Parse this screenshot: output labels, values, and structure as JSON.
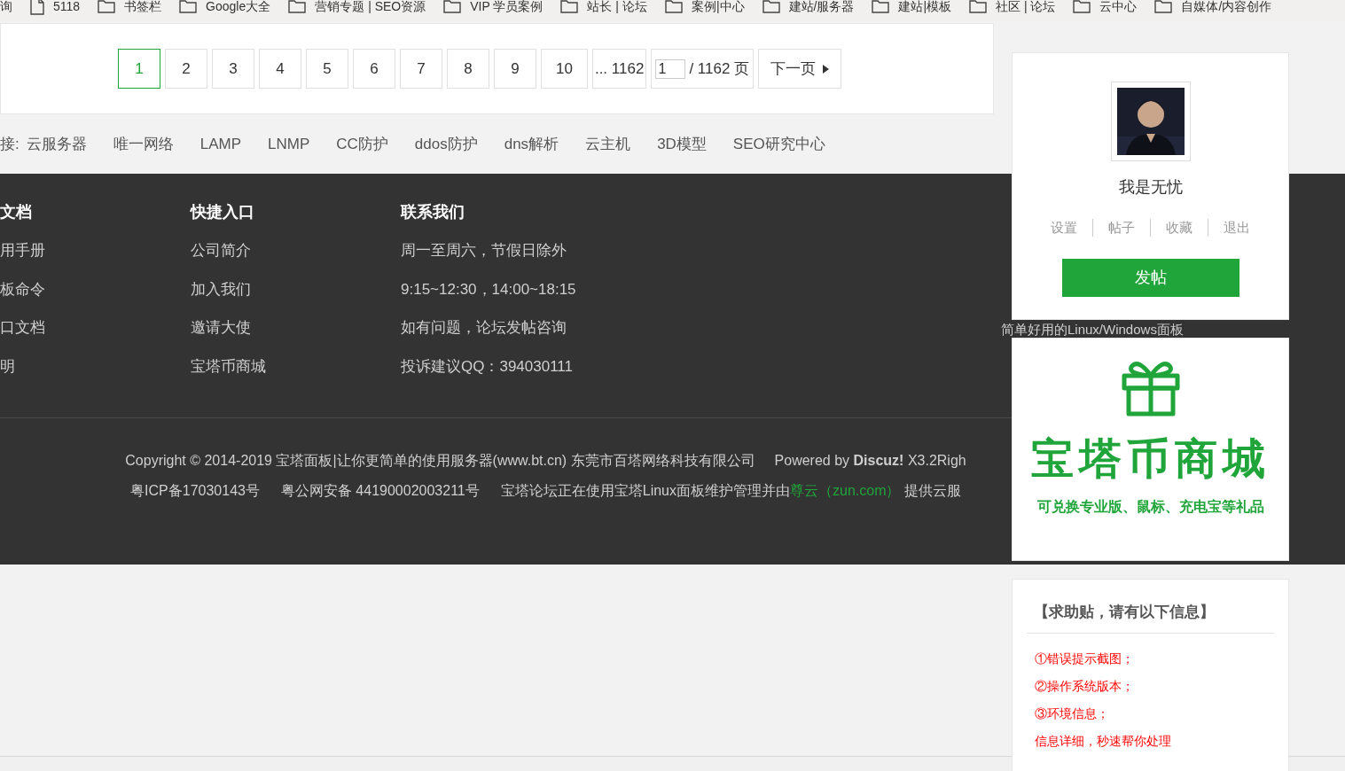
{
  "bookmarks": [
    {
      "kind": "text",
      "label": "询"
    },
    {
      "kind": "page",
      "label": "5118"
    },
    {
      "kind": "folder",
      "label": "书签栏"
    },
    {
      "kind": "folder",
      "label": "Google大全"
    },
    {
      "kind": "folder",
      "label": "营销专题 | SEO资源"
    },
    {
      "kind": "folder",
      "label": "VIP 学员案例"
    },
    {
      "kind": "folder",
      "label": "站长 | 论坛"
    },
    {
      "kind": "folder",
      "label": "案例|中心"
    },
    {
      "kind": "folder",
      "label": "建站/服务器"
    },
    {
      "kind": "folder",
      "label": "建站|模板"
    },
    {
      "kind": "folder",
      "label": "社区 | 论坛"
    },
    {
      "kind": "folder",
      "label": "云中心"
    },
    {
      "kind": "folder",
      "label": "自媒体/内容创作"
    }
  ],
  "pagination": {
    "pages": [
      {
        "label": "1",
        "selected": true
      },
      {
        "label": "2",
        "selected": false
      },
      {
        "label": "3",
        "selected": false
      },
      {
        "label": "4",
        "selected": false
      },
      {
        "label": "5",
        "selected": false
      },
      {
        "label": "6",
        "selected": false
      },
      {
        "label": "7",
        "selected": false
      },
      {
        "label": "8",
        "selected": false
      },
      {
        "label": "9",
        "selected": false
      },
      {
        "label": "10",
        "selected": false
      }
    ],
    "last": "... 1162",
    "page_input": "1",
    "total": "/ 1162 页",
    "next": "下一页"
  },
  "links": {
    "label": "接:",
    "items": [
      "云服务器",
      "唯一网络",
      "LAMP",
      "LNMP",
      "CC防护",
      "ddos防护",
      "dns解析",
      "云主机",
      "3D模型",
      "SEO研究中心"
    ]
  },
  "footer": {
    "columns": [
      {
        "title": "文档",
        "items": [
          "用手册",
          "板命令",
          "口文档",
          "明"
        ]
      },
      {
        "title": "快捷入口",
        "items": [
          "公司简介",
          "加入我们",
          "邀请大使",
          "宝塔币商城"
        ]
      },
      {
        "title": "联系我们",
        "items": [
          "周一至周六，节假日除外",
          "9:15~12:30，14:00~18:15",
          "如有问题，论坛发帖咨询",
          "投诉建议QQ：394030111"
        ]
      }
    ],
    "tagline": "简单好用的Linux/Windows面板",
    "copyright": "Copyright © 2014-2019 宝塔面板|让你更简单的使用服务器(www.bt.cn) 东莞市百塔网络科技有限公司",
    "powered": "Powered by **Discuz!** X3.2Righ",
    "icp": "粤ICP备17030143号",
    "police": "粤公网安备 44190002003211号",
    "notice": "宝塔论坛正在使用宝塔Linux面板维护管理并由",
    "notice_link": "尊云（zun.com）",
    "notice_tail": "提供云服"
  },
  "user": {
    "name": "我是无忧",
    "actions": [
      "设置",
      "帖子",
      "收藏",
      "退出"
    ],
    "post_button": "发帖"
  },
  "promo": {
    "title": "宝塔币商城",
    "subtitle": "可兑换专业版、鼠标、充电宝等礼品"
  },
  "help": {
    "title": "【求助贴，请有以下信息】",
    "lines": [
      "①错误提示截图；",
      "②操作系统版本；",
      "③环境信息；",
      "信息详细，秒速帮你处理"
    ]
  }
}
